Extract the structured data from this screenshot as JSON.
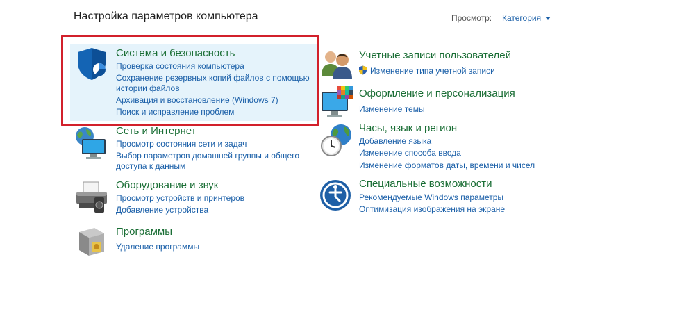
{
  "header": {
    "title": "Настройка параметров компьютера",
    "view_by_label": "Просмотр:",
    "view_by_value": "Категория"
  },
  "categories": {
    "system": {
      "title": "Система и безопасность",
      "links": [
        "Проверка состояния компьютера",
        "Сохранение резервных копий файлов с помощью",
        "истории файлов",
        "Архивация и восстановление (Windows 7)",
        "Поиск и исправление проблем"
      ]
    },
    "network": {
      "title": "Сеть и Интернет",
      "links": [
        "Просмотр состояния сети и задач",
        "Выбор параметров домашней группы и общего",
        "доступа к данным"
      ]
    },
    "hardware": {
      "title": "Оборудование и звук",
      "links": [
        "Просмотр устройств и принтеров",
        "Добавление устройства"
      ]
    },
    "programs": {
      "title": "Программы",
      "links": [
        "Удаление программы"
      ]
    },
    "accounts": {
      "title": "Учетные записи пользователей",
      "links": [
        "Изменение типа учетной записи"
      ]
    },
    "appearance": {
      "title": "Оформление и персонализация",
      "links": [
        "Изменение темы"
      ]
    },
    "clock": {
      "title": "Часы, язык и регион",
      "links": [
        "Добавление языка",
        "Изменение способа ввода",
        "Изменение форматов даты, времени и чисел"
      ]
    },
    "ease": {
      "title": "Специальные возможности",
      "links": [
        "Рекомендуемые Windows параметры",
        "Оптимизация изображения на экране"
      ]
    }
  },
  "colors": {
    "category_title": "#1a6e35",
    "link": "#1a5fa8",
    "highlight_bg": "#e5f3fb",
    "highlight_frame": "#d2202b"
  },
  "icons": {
    "system": "shield-icon",
    "network": "network-globe-icon",
    "hardware": "printer-icon",
    "programs": "programs-box-icon",
    "accounts": "users-icon",
    "appearance": "monitor-palette-icon",
    "clock": "clock-globe-icon",
    "ease": "ease-of-access-icon",
    "uac": "uac-shield-icon"
  }
}
